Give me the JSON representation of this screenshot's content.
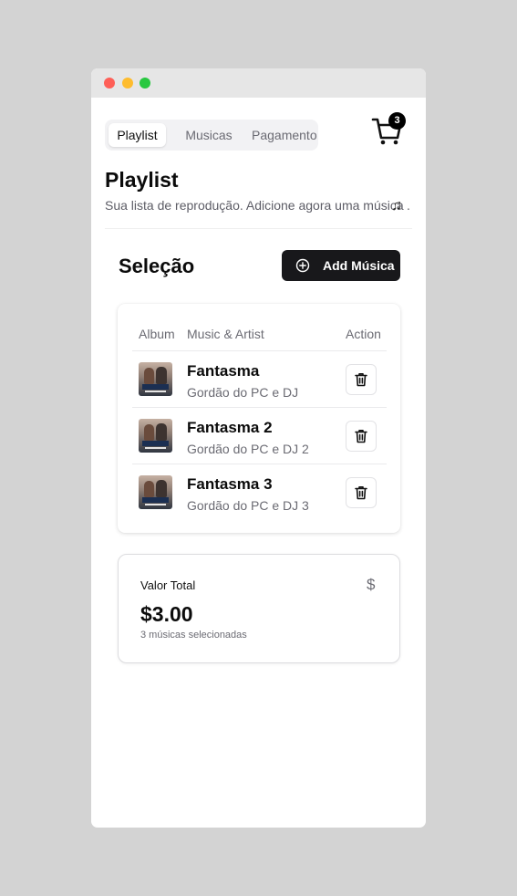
{
  "tabs": [
    {
      "label": "Playlist",
      "active": true
    },
    {
      "label": "Musicas",
      "active": false
    },
    {
      "label": "Pagamento",
      "active": false
    }
  ],
  "cart": {
    "icon": "shopping-cart-icon",
    "count": "3"
  },
  "header": {
    "title": "Playlist",
    "subtitle": "Sua lista de reprodução. Adicione agora uma música",
    "subtitle_icon": "♫",
    "subtitle_end": "."
  },
  "selection": {
    "title": "Seleção",
    "add_button_label": "Add Música",
    "add_button_icon": "plus-circle-icon"
  },
  "table": {
    "headers": [
      "Album",
      "Music & Artist",
      "Action"
    ],
    "rows": [
      {
        "title": "Fantasma",
        "artist": "Gordão do PC e DJ"
      },
      {
        "title": "Fantasma 2",
        "artist": "Gordão do PC e DJ 2"
      },
      {
        "title": "Fantasma 3",
        "artist": "Gordão do PC e DJ 3"
      }
    ]
  },
  "total": {
    "label": "Valor Total",
    "currency_symbol": "$",
    "value": "$3.00",
    "note": "3 músicas selecionadas"
  },
  "colors": {
    "background": "#d3d3d3",
    "primary_button": "#18181b",
    "badge": "#000000",
    "muted_text": "#6b6b73"
  }
}
